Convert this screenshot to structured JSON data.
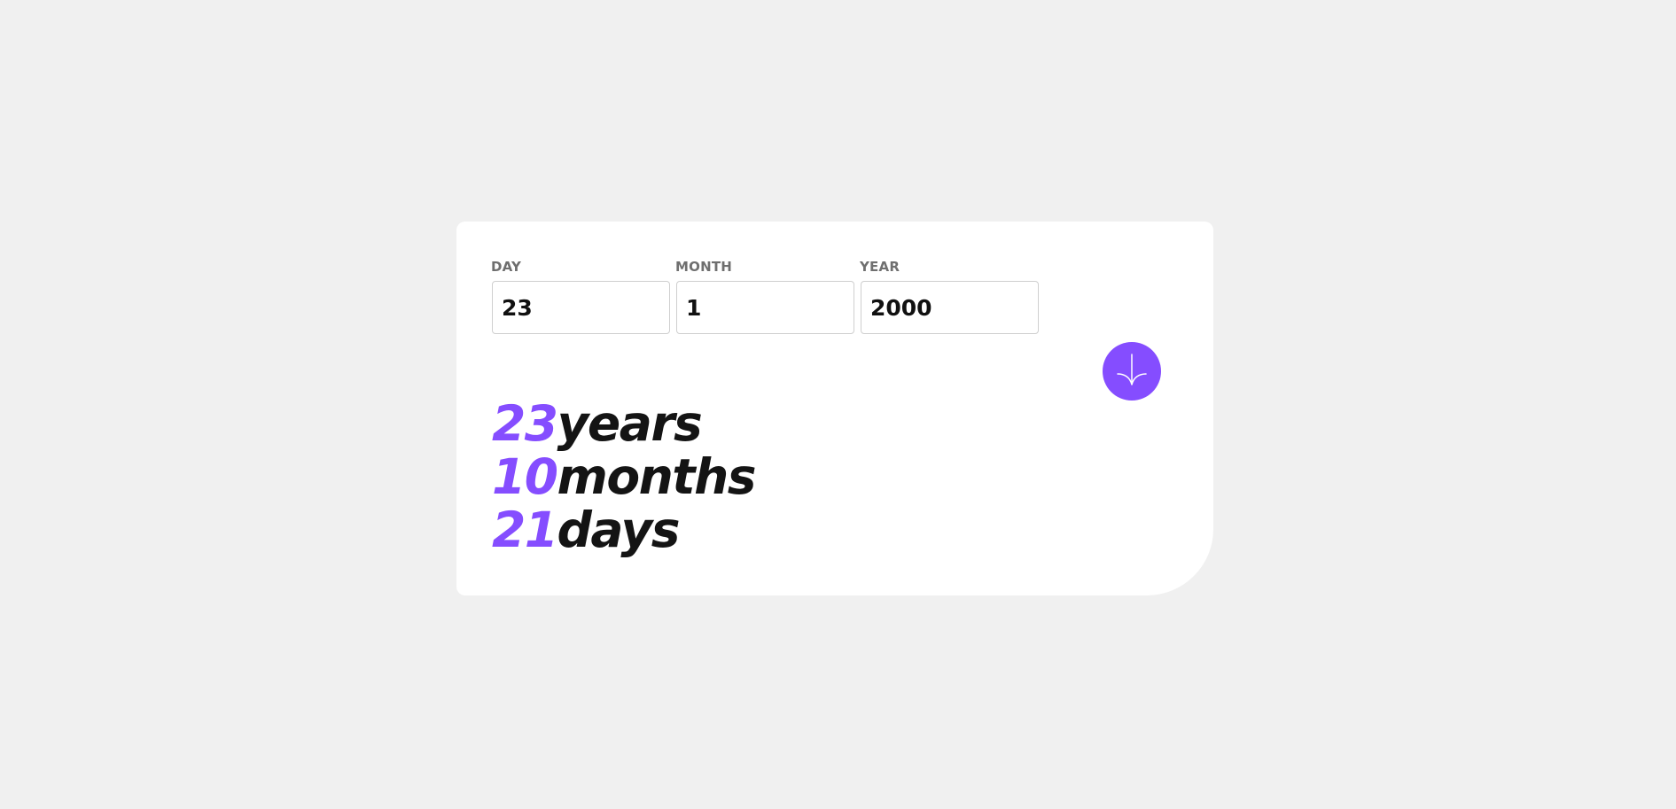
{
  "colors": {
    "background": "#f0f0f0",
    "card": "#ffffff",
    "accent": "#854dff",
    "label": "#6f6f6f",
    "text": "#141414"
  },
  "form": {
    "day": {
      "label": "DAY",
      "value": "23"
    },
    "month": {
      "label": "MONTH",
      "value": "1"
    },
    "year": {
      "label": "YEAR",
      "value": "2000"
    },
    "submit_icon": "arrow-down-icon"
  },
  "results": {
    "years": {
      "value": "23",
      "unit": "years"
    },
    "months": {
      "value": "10",
      "unit": "months"
    },
    "days": {
      "value": "21",
      "unit": "days"
    }
  }
}
